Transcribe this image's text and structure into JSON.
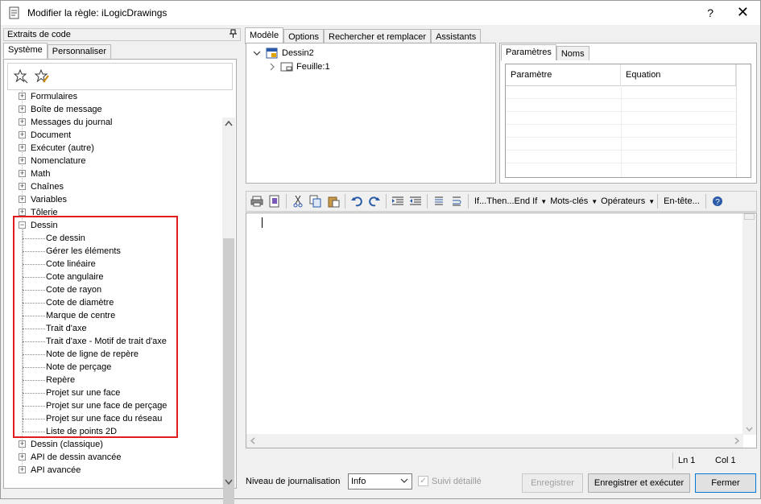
{
  "window": {
    "title": "Modifier la règle: iLogicDrawings",
    "help": "?",
    "close": "✕"
  },
  "left_panel": {
    "header": "Extraits de code",
    "pin": "📌",
    "tabs": [
      "Système",
      "Personnaliser"
    ],
    "tree": [
      {
        "label": "Formulaires",
        "level": 0,
        "expander": "+"
      },
      {
        "label": "Boîte de message",
        "level": 0,
        "expander": "+"
      },
      {
        "label": "Messages du journal",
        "level": 0,
        "expander": "+"
      },
      {
        "label": "Document",
        "level": 0,
        "expander": "+"
      },
      {
        "label": "Exécuter (autre)",
        "level": 0,
        "expander": "+"
      },
      {
        "label": "Nomenclature",
        "level": 0,
        "expander": "+"
      },
      {
        "label": "Math",
        "level": 0,
        "expander": "+"
      },
      {
        "label": "Chaînes",
        "level": 0,
        "expander": "+"
      },
      {
        "label": "Variables",
        "level": 0,
        "expander": "+"
      },
      {
        "label": "Tôlerie",
        "level": 0,
        "expander": "+"
      },
      {
        "label": "Dessin",
        "level": 0,
        "expander": "−"
      },
      {
        "label": "Ce dessin",
        "level": 1
      },
      {
        "label": "Gérer les éléments",
        "level": 1
      },
      {
        "label": "Cote linéaire",
        "level": 1
      },
      {
        "label": "Cote angulaire",
        "level": 1
      },
      {
        "label": "Cote de rayon",
        "level": 1
      },
      {
        "label": "Cote de diamètre",
        "level": 1
      },
      {
        "label": "Marque de centre",
        "level": 1
      },
      {
        "label": "Trait d'axe",
        "level": 1
      },
      {
        "label": "Trait d'axe - Motif de trait d'axe",
        "level": 1
      },
      {
        "label": "Note de ligne de repère",
        "level": 1
      },
      {
        "label": "Note de perçage",
        "level": 1
      },
      {
        "label": "Repère",
        "level": 1
      },
      {
        "label": "Projet sur une face",
        "level": 1
      },
      {
        "label": "Projet sur une face de perçage",
        "level": 1
      },
      {
        "label": "Projet sur une face du réseau",
        "level": 1
      },
      {
        "label": "Liste de points 2D",
        "level": 1
      },
      {
        "label": "Dessin (classique)",
        "level": 0,
        "expander": "+"
      },
      {
        "label": "API de dessin avancée",
        "level": 0,
        "expander": "+"
      },
      {
        "label": "API avancée",
        "level": 0,
        "expander": "+"
      }
    ]
  },
  "right_tabs": [
    "Modèle",
    "Options",
    "Rechercher et remplacer",
    "Assistants"
  ],
  "model_tree": {
    "root": "Dessin2",
    "child": "Feuille:1"
  },
  "param_tabs": [
    "Paramètres",
    "Noms"
  ],
  "param_grid": {
    "col1": "Paramètre",
    "col2": "Equation"
  },
  "editor_toolbar": {
    "if_then": "If...Then...End If",
    "keywords": "Mots-clés",
    "operators": "Opérateurs",
    "header": "En-tête..."
  },
  "status": {
    "line": "Ln 1",
    "col": "Col 1"
  },
  "bottom": {
    "log_label": "Niveau de journalisation",
    "log_value": "Info",
    "detailed": "Suivi détaillé",
    "save": "Enregistrer",
    "save_run": "Enregistrer et exécuter",
    "close": "Fermer"
  }
}
